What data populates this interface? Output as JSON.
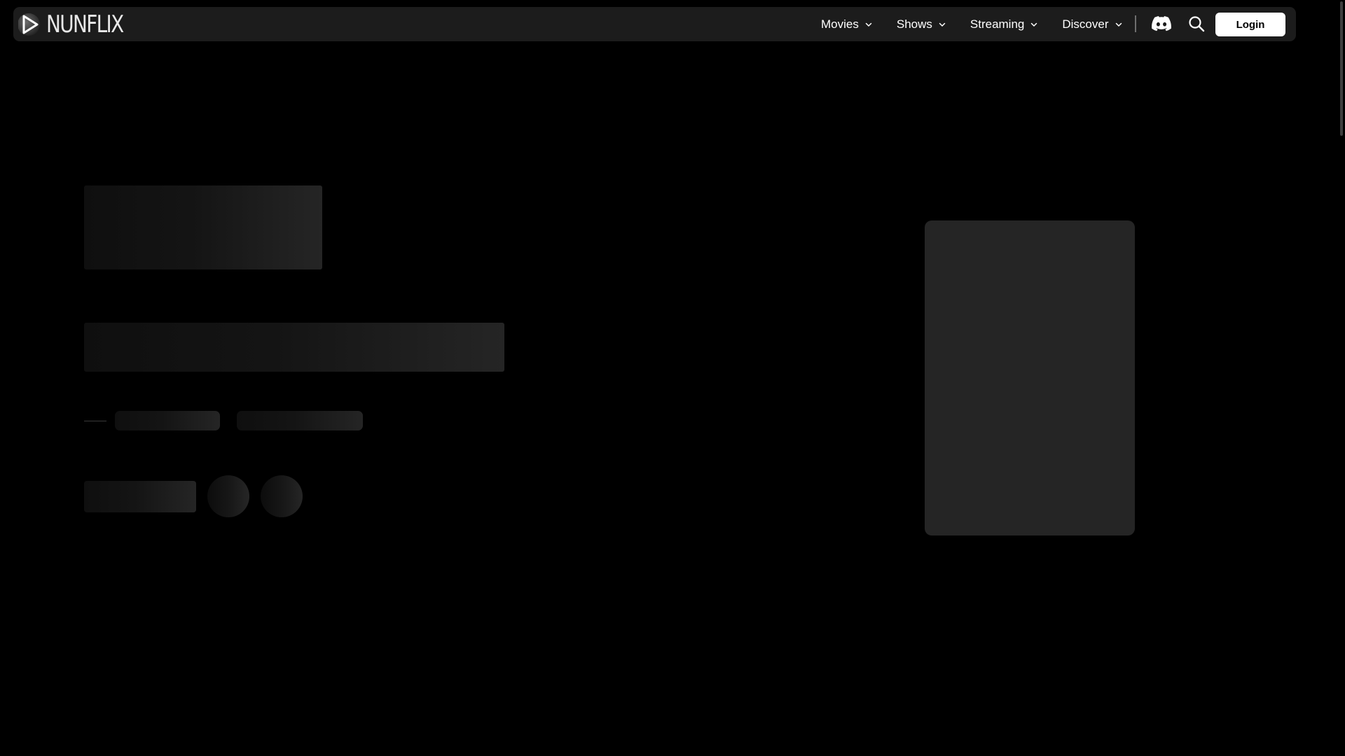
{
  "app": {
    "logo_text": "NUNFLIX"
  },
  "nav": {
    "items": [
      {
        "label": "Movies",
        "icon": "chevron-down-icon"
      },
      {
        "label": "Shows",
        "icon": "chevron-down-icon"
      },
      {
        "label": "Streaming",
        "icon": "chevron-down-icon"
      },
      {
        "label": "Discover",
        "icon": "chevron-down-icon"
      }
    ],
    "icons": [
      "discord-icon",
      "search-icon"
    ],
    "login_label": "Login"
  },
  "theme": {
    "background": "#000000",
    "navbar_bg": "#1c1c1c",
    "text": "#ffffff",
    "skeleton": "#252525"
  }
}
